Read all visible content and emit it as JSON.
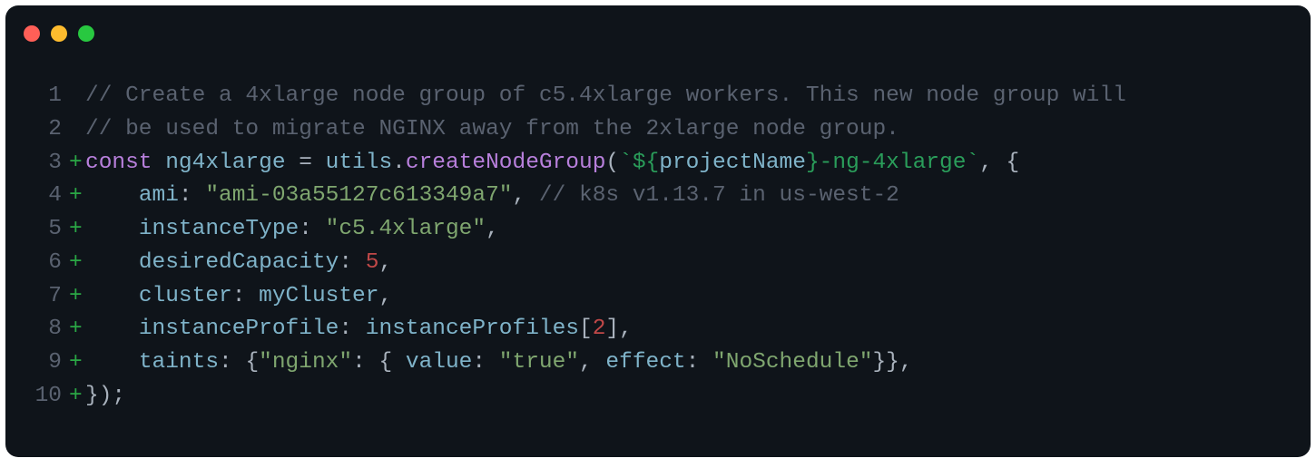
{
  "traffic_lights": {
    "close": "#ff5f57",
    "minimize": "#febc2e",
    "zoom": "#28c840"
  },
  "gutter": [
    "1",
    "2",
    "3",
    "4",
    "5",
    "6",
    "7",
    "8",
    "9",
    "10"
  ],
  "diff": [
    "",
    "",
    "+",
    "+",
    "+",
    "+",
    "+",
    "+",
    "+",
    "+"
  ],
  "tokens": {
    "l1_comment": "// Create a 4xlarge node group of c5.4xlarge workers. This new node group will",
    "l2_comment": "// be used to migrate NGINX away from the 2xlarge node group.",
    "l3_const": "const",
    "l3_name": "ng4xlarge",
    "l3_eq": " = ",
    "l3_utils": "utils",
    "l3_dot": ".",
    "l3_fn": "createNodeGroup",
    "l3_open": "(",
    "l3_tick1": "`",
    "l3_interp_open": "${",
    "l3_projname": "projectName",
    "l3_interp_close": "}",
    "l3_suffix": "-ng-4xlarge",
    "l3_tick2": "`",
    "l3_comma_brace": ", {",
    "l4_indent": "    ",
    "l4_key": "ami",
    "l4_colon": ": ",
    "l4_val": "\"ami-03a55127c613349a7\"",
    "l4_comma": ",",
    "l4_comment": " // k8s v1.13.7 in us-west-2",
    "l5_indent": "    ",
    "l5_key": "instanceType",
    "l5_colon": ": ",
    "l5_val": "\"c5.4xlarge\"",
    "l5_comma": ",",
    "l6_indent": "    ",
    "l6_key": "desiredCapacity",
    "l6_colon": ": ",
    "l6_val": "5",
    "l6_comma": ",",
    "l7_indent": "    ",
    "l7_key": "cluster",
    "l7_colon": ": ",
    "l7_val": "myCluster",
    "l7_comma": ",",
    "l8_indent": "    ",
    "l8_key": "instanceProfile",
    "l8_colon": ": ",
    "l8_base": "instanceProfiles",
    "l8_lbr": "[",
    "l8_idx": "2",
    "l8_rbr": "]",
    "l8_comma": ",",
    "l9_indent": "    ",
    "l9_key": "taints",
    "l9_colon": ": ",
    "l9_open": "{",
    "l9_nginx": "\"nginx\"",
    "l9_colon2": ": ",
    "l9_open2": "{ ",
    "l9_valuek": "value",
    "l9_colon3": ": ",
    "l9_valq": "\"true\"",
    "l9_comma1": ", ",
    "l9_effectk": "effect",
    "l9_colon4": ": ",
    "l9_effq": "\"NoSchedule\"",
    "l9_close2": "}}",
    "l9_comma": ",",
    "l10_close": "});"
  }
}
